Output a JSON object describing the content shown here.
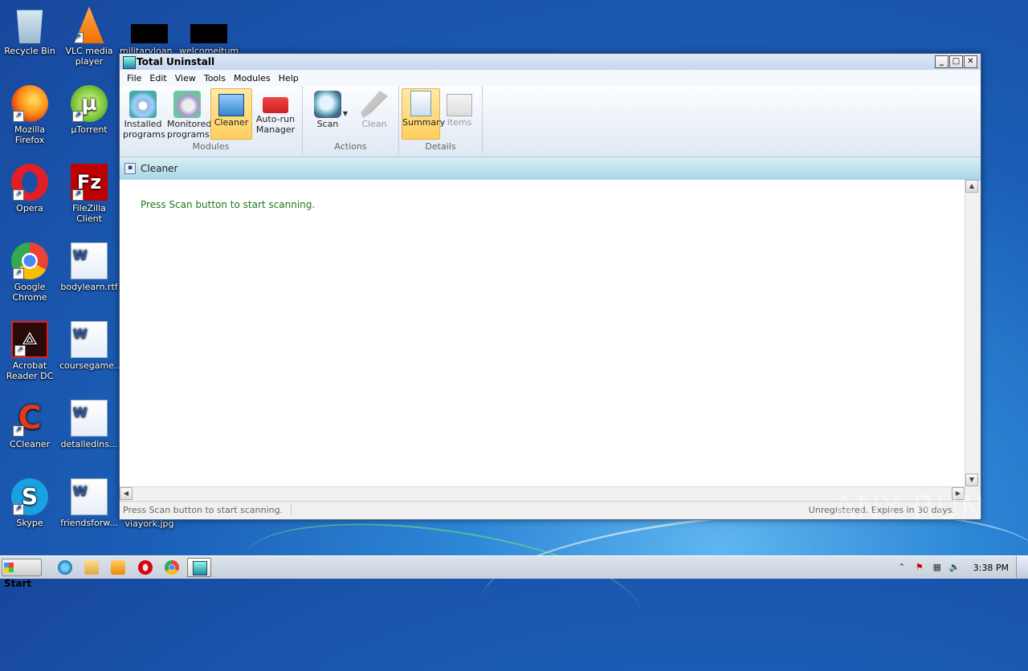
{
  "desktop": {
    "icons": [
      {
        "label": "Recycle Bin"
      },
      {
        "label": "VLC media player"
      },
      {
        "label": "militaryloan..."
      },
      {
        "label": "welcomeitum..."
      },
      {
        "label": "Mozilla Firefox"
      },
      {
        "label": "µTorrent"
      },
      {
        "label": "Opera"
      },
      {
        "label": "FileZilla Client"
      },
      {
        "label": "Google Chrome"
      },
      {
        "label": "bodylearn.rtf"
      },
      {
        "label": "Acrobat Reader DC"
      },
      {
        "label": "coursegame..."
      },
      {
        "label": "CCleaner"
      },
      {
        "label": "detalledins..."
      },
      {
        "label": "Skype"
      },
      {
        "label": "friendsforw..."
      },
      {
        "label": "viayork.jpg"
      }
    ]
  },
  "window": {
    "title": "Total Uninstall",
    "controls": {
      "minimize": "_",
      "maximize": "□",
      "close": "✕"
    },
    "menu": [
      "File",
      "Edit",
      "View",
      "Tools",
      "Modules",
      "Help"
    ],
    "ribbon": {
      "modules": {
        "label": "Modules",
        "buttons": [
          {
            "label": "Installed programs",
            "icon": "installed-programs-icon"
          },
          {
            "label": "Monitored programs",
            "icon": "monitored-programs-icon"
          },
          {
            "label": "Cleaner",
            "icon": "cleaner-icon",
            "active": true
          },
          {
            "label": "Auto-run Manager",
            "icon": "autorun-manager-icon"
          }
        ]
      },
      "actions": {
        "label": "Actions",
        "buttons": [
          {
            "label": "Scan",
            "icon": "scan-icon"
          },
          {
            "label": "Clean",
            "icon": "clean-icon",
            "disabled": true
          }
        ]
      },
      "details": {
        "label": "Details",
        "buttons": [
          {
            "label": "Summary",
            "icon": "summary-icon",
            "active": true
          },
          {
            "label": "Items",
            "icon": "items-icon",
            "disabled": true
          }
        ]
      }
    },
    "panel_title": "Cleaner",
    "message": "Press Scan button to start scanning.",
    "status": {
      "left": "Press Scan button to start scanning.",
      "right": "Unregistered. Expires in 30 days."
    }
  },
  "taskbar": {
    "start_label": "Start",
    "clock": "3:38 PM"
  },
  "watermark": "ANY RUN"
}
